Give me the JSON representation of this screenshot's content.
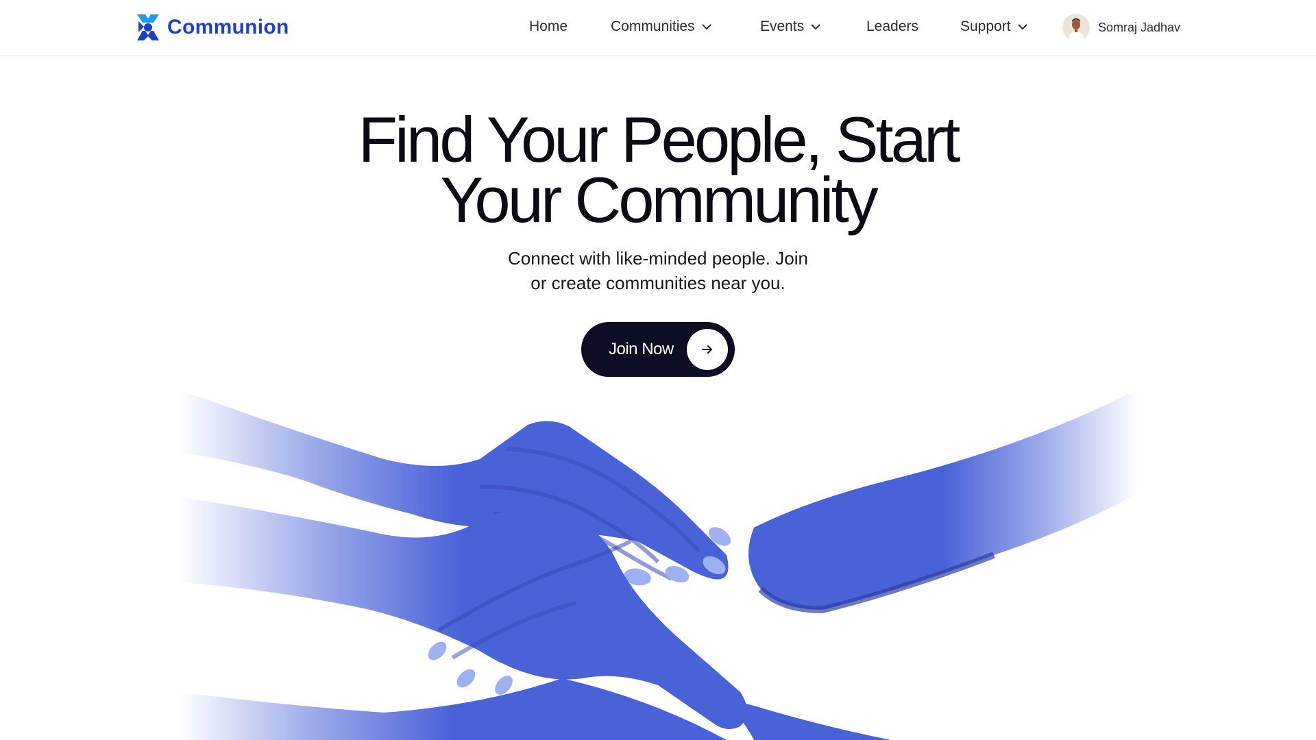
{
  "brand": {
    "name": "Communion",
    "color": "#1f3fc9",
    "accent": "#1b9cf0"
  },
  "nav": {
    "items": [
      {
        "label": "Home",
        "dropdown": false
      },
      {
        "label": "Communities",
        "dropdown": true
      },
      {
        "label": "Events",
        "dropdown": true
      },
      {
        "label": "Leaders",
        "dropdown": false
      },
      {
        "label": "Support",
        "dropdown": true
      }
    ],
    "user": {
      "name": "Somraj Jadhav"
    }
  },
  "hero": {
    "title_line1": "Find Your People, Start",
    "title_line2": "Your Community",
    "subtitle_line1": "Connect with like-minded people. Join",
    "subtitle_line2": "or create communities near you.",
    "cta_label": "Join Now",
    "cta_color": "#0e0d26"
  },
  "illustration": {
    "subject": "clasped-hands",
    "color": "#4a62d8"
  }
}
